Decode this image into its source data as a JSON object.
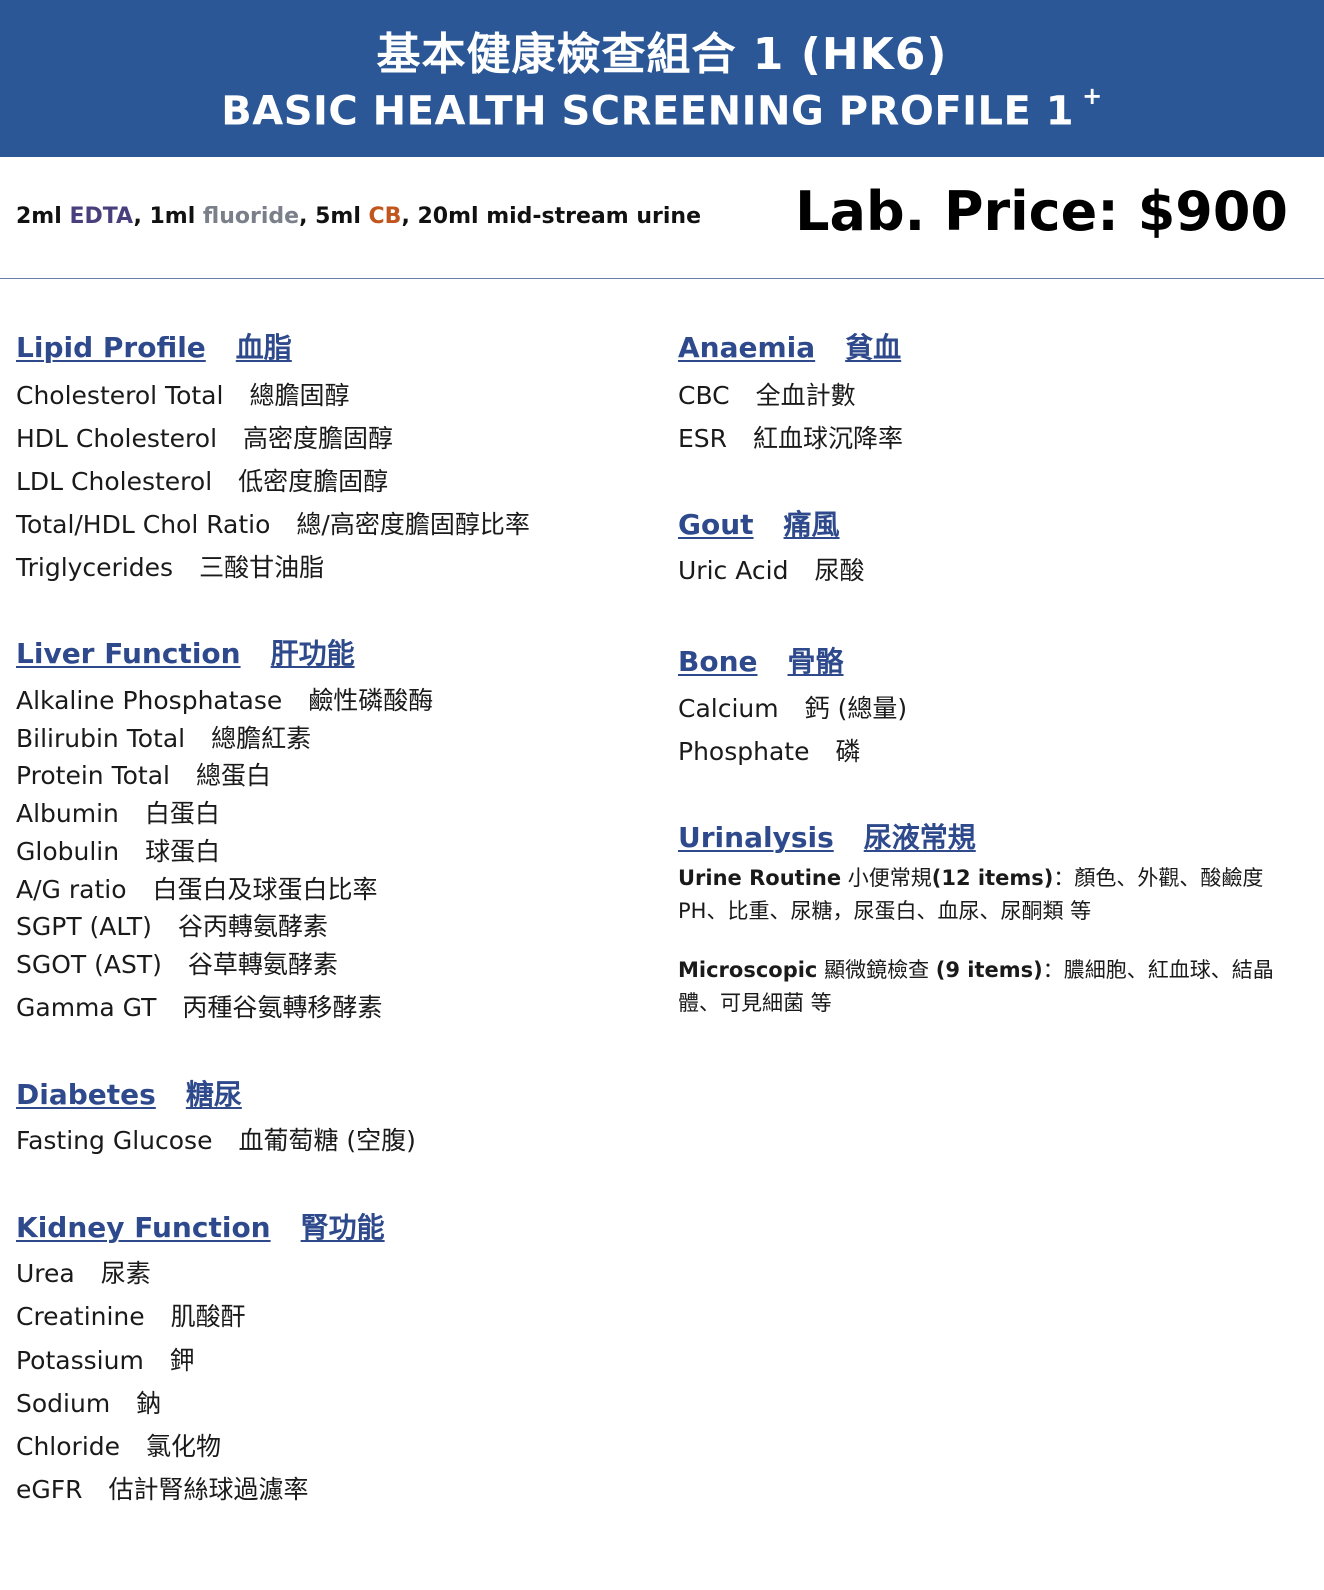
{
  "header": {
    "title_zh": "基本健康檢查組合 1 (HK6)",
    "title_en": "BASIC HEALTH SCREENING PROFILE 1",
    "title_mark": "+"
  },
  "sample": {
    "p1": "2ml ",
    "edta": "EDTA",
    "p2": ", 1ml ",
    "fluoride": "fluoride",
    "p3": ", 5ml ",
    "cb": "CB",
    "p4": ", 20ml mid-stream urine"
  },
  "price": "Lab. Price: $900",
  "sections": {
    "lipid": {
      "title_en": "Lipid Profile",
      "title_zh": "血脂",
      "items": [
        {
          "en": "Cholesterol Total",
          "zh": "總膽固醇"
        },
        {
          "en": "HDL Cholesterol",
          "zh": "高密度膽固醇"
        },
        {
          "en": "LDL Cholesterol",
          "zh": "低密度膽固醇"
        },
        {
          "en": "Total/HDL Chol Ratio",
          "zh": "總/高密度膽固醇比率"
        },
        {
          "en": "Triglycerides",
          "zh": "三酸甘油脂"
        }
      ]
    },
    "liver": {
      "title_en": "Liver Function",
      "title_zh": "肝功能",
      "items": [
        {
          "en": "Alkaline Phosphatase",
          "zh": "鹼性磷酸酶"
        },
        {
          "en": "Bilirubin Total",
          "zh": "總膽紅素"
        },
        {
          "en": "Protein Total",
          "zh": "總蛋白"
        },
        {
          "en": "Albumin",
          "zh": "白蛋白"
        },
        {
          "en": "Globulin",
          "zh": "球蛋白"
        },
        {
          "en": "A/G ratio",
          "zh": "白蛋白及球蛋白比率"
        },
        {
          "en": "SGPT (ALT)",
          "zh": "谷丙轉氨酵素"
        },
        {
          "en": "SGOT (AST)",
          "zh": "谷草轉氨酵素"
        },
        {
          "en": "Gamma GT",
          "zh": "丙種谷氨轉移酵素"
        }
      ]
    },
    "diabetes": {
      "title_en": "Diabetes",
      "title_zh": "糖尿",
      "items": [
        {
          "en": "Fasting Glucose",
          "zh": "血葡萄糖 (空腹)"
        }
      ]
    },
    "kidney": {
      "title_en": "Kidney Function",
      "title_zh": "腎功能",
      "items": [
        {
          "en": "Urea",
          "zh": "尿素"
        },
        {
          "en": "Creatinine",
          "zh": "肌酸酐"
        },
        {
          "en": "Potassium",
          "zh": "鉀"
        },
        {
          "en": "Sodium",
          "zh": "鈉"
        },
        {
          "en": "Chloride",
          "zh": "氯化物"
        },
        {
          "en": "eGFR",
          "zh": "估計腎絲球過濾率"
        }
      ]
    },
    "anaemia": {
      "title_en": "Anaemia",
      "title_zh": "貧血",
      "items": [
        {
          "en": "CBC",
          "zh": "全血計數"
        },
        {
          "en": "ESR",
          "zh": "紅血球沉降率"
        }
      ]
    },
    "gout": {
      "title_en": "Gout",
      "title_zh": "痛風",
      "items": [
        {
          "en": "Uric Acid",
          "zh": "尿酸"
        }
      ]
    },
    "bone": {
      "title_en": "Bone",
      "title_zh": "骨骼",
      "items": [
        {
          "en": "Calcium",
          "zh": "鈣 (總量)"
        },
        {
          "en": "Phosphate",
          "zh": "磷"
        }
      ]
    },
    "urinalysis": {
      "title_en": "Urinalysis",
      "title_zh": "尿液常規",
      "routine_label": "Urine Routine",
      "routine_zh": " 小便常規",
      "routine_count": "(12 items)",
      "routine_desc": "：顏色、外觀、酸鹼度 PH、比重、尿糖，尿蛋白、血尿、尿酮類 等",
      "micro_label": "Microscopic",
      "micro_zh": " 顯微鏡檢查 ",
      "micro_count": "(9 items)",
      "micro_desc": "：膿細胞、紅血球、結晶體、可見細菌 等"
    }
  }
}
